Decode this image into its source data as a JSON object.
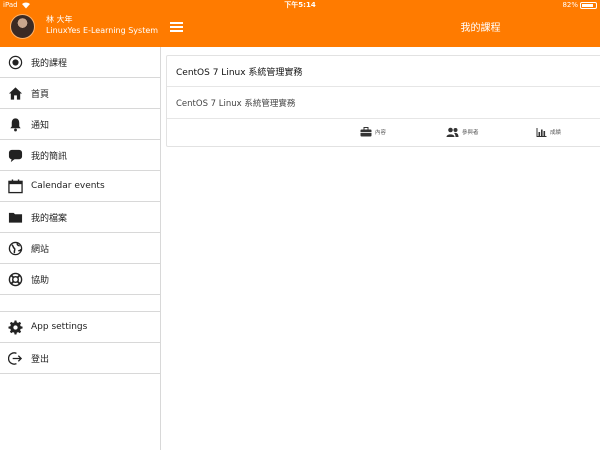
{
  "statusbar": {
    "carrier": "iPad",
    "time": "下午5:14",
    "battery": "82%"
  },
  "sidebar": {
    "user_name": "林 大年",
    "site_name": "LinuxYes E-Learning System",
    "items": [
      {
        "label": "我的課程",
        "icon": "radio-target-icon"
      },
      {
        "label": "首頁",
        "icon": "home-icon"
      },
      {
        "label": "通知",
        "icon": "bell-icon"
      },
      {
        "label": "我的簡訊",
        "icon": "chat-bubble-icon"
      },
      {
        "label": "Calendar events",
        "icon": "calendar-icon"
      },
      {
        "label": "我的檔案",
        "icon": "folder-icon"
      },
      {
        "label": "網站",
        "icon": "globe-icon"
      },
      {
        "label": "協助",
        "icon": "lifebuoy-icon"
      },
      {
        "label": "App settings",
        "icon": "gear-icon"
      },
      {
        "label": "登出",
        "icon": "logout-icon"
      }
    ]
  },
  "header": {
    "title": "我的課程",
    "accent": "#ff7b00"
  },
  "course": {
    "title": "CentOS 7 Linux 系統管理實務",
    "summary": "CentOS 7 Linux 系統管理實務",
    "actions": [
      {
        "label": "內容",
        "icon": "briefcase-icon"
      },
      {
        "label": "參與者",
        "icon": "users-icon"
      },
      {
        "label": "成績",
        "icon": "bar-chart-icon"
      }
    ]
  }
}
